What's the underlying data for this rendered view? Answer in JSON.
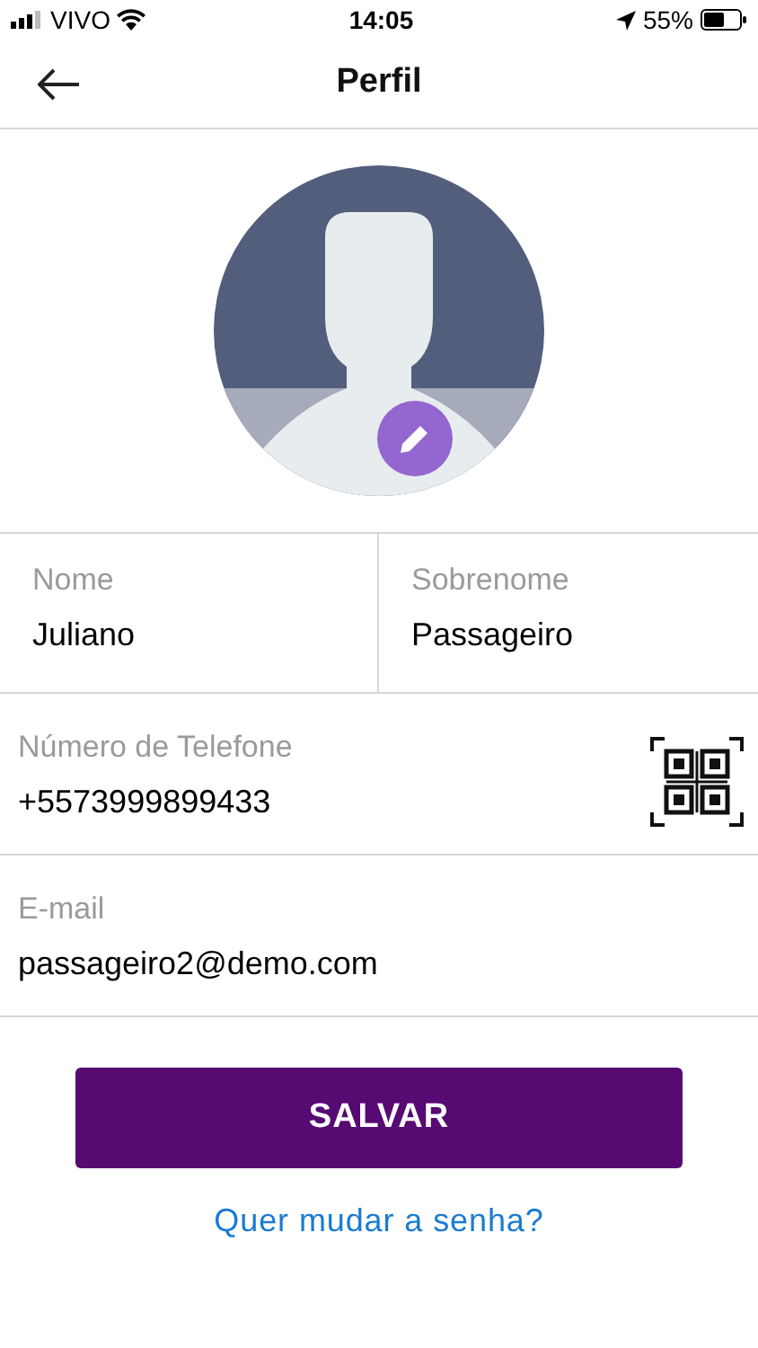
{
  "status_bar": {
    "carrier": "VIVO",
    "time": "14:05",
    "battery": "55%"
  },
  "header": {
    "title": "Perfil"
  },
  "fields": [
    {
      "label": "Nome",
      "value": "Juliano"
    },
    {
      "label": "Sobrenome",
      "value": "Passageiro"
    },
    {
      "label": "Número de Telefone",
      "value": "+5573999899433"
    },
    {
      "label": "E-mail",
      "value": "passageiro2@demo.com"
    }
  ],
  "save_button": "SALVAR",
  "change_password_link": "Quer mudar a senha?"
}
